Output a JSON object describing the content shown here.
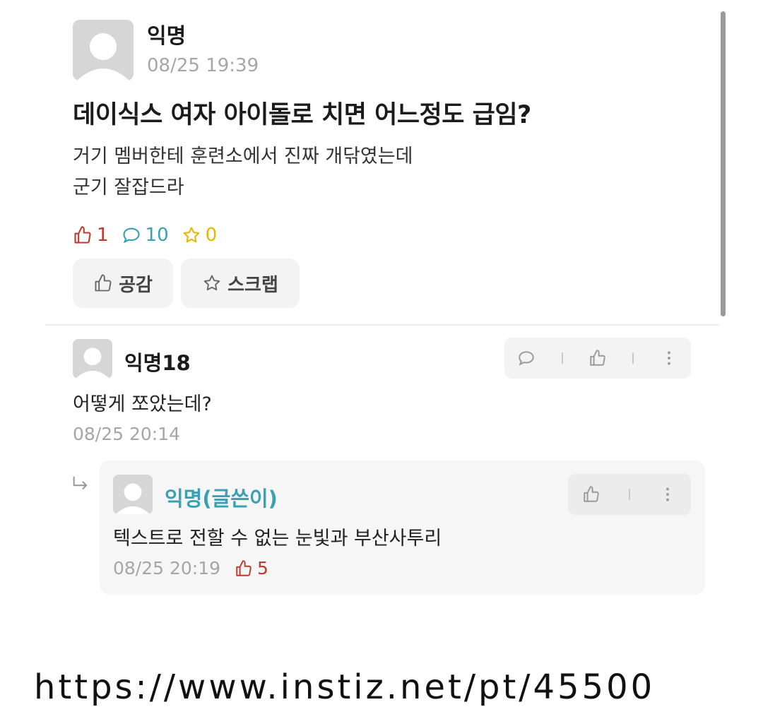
{
  "post": {
    "author": "익명",
    "time": "08/25 19:39",
    "title": "데이식스 여자 아이돌로 치면 어느정도 급임?",
    "body_lines": [
      "거기 멤버한테 훈련소에서 진짜 개닦였는데",
      "군기 잘잡드라"
    ],
    "stats": {
      "likes": "1",
      "comments": "10",
      "scraps": "0"
    },
    "buttons": {
      "like_label": "공감",
      "scrap_label": "스크랩"
    }
  },
  "comments": [
    {
      "author": "익명18",
      "text": "어떻게 쪼았는데?",
      "time": "08/25 20:14",
      "reply": {
        "author": "익명(글쓴이)",
        "text": "텍스트로 전할 수 없는 눈빛과 부산사투리",
        "time": "08/25 20:19",
        "likes": "5"
      }
    }
  ],
  "colors": {
    "like": "#c0392b",
    "comment": "#3aa0b4",
    "scrap": "#e6b800",
    "writer": "#3aa0b4"
  },
  "footer": {
    "partial_text": "https://www.instiz.net/pt/45500"
  }
}
